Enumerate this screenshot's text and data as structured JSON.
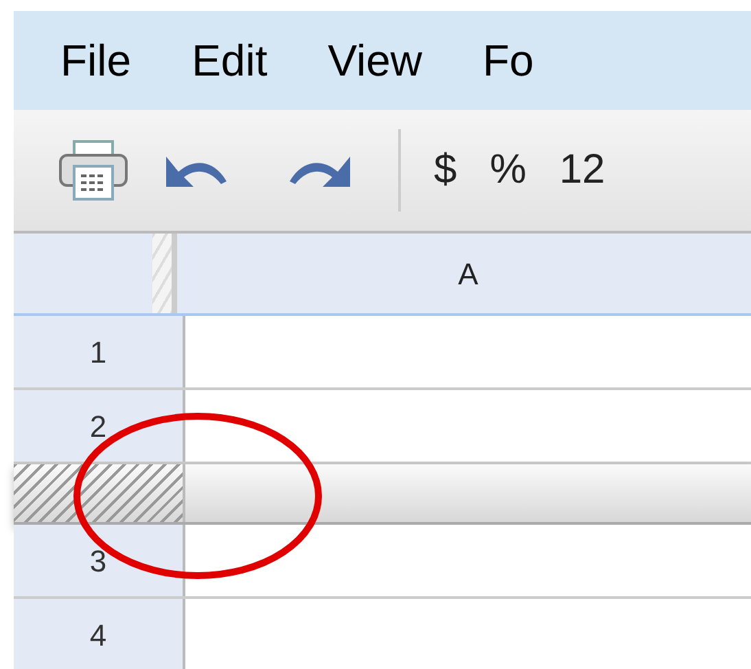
{
  "menu": [
    {
      "label": "File"
    },
    {
      "label": "Edit"
    },
    {
      "label": "View"
    },
    {
      "label": "Fo"
    }
  ],
  "toolbar": [
    {
      "kind": "print"
    },
    {
      "kind": "undo"
    },
    {
      "kind": "redo"
    },
    {
      "kind": "separator"
    },
    {
      "kind": "text",
      "label": "$"
    },
    {
      "kind": "text",
      "label": "%"
    },
    {
      "kind": "text",
      "label": "12"
    }
  ],
  "column_headers": [
    "A"
  ],
  "rows": [
    {
      "kind": "row",
      "label": "1"
    },
    {
      "kind": "row",
      "label": "2"
    },
    {
      "kind": "freeze-bar"
    },
    {
      "kind": "row",
      "label": "3"
    },
    {
      "kind": "row",
      "label": "4"
    }
  ],
  "annotation": {
    "kind": "ellipse"
  }
}
